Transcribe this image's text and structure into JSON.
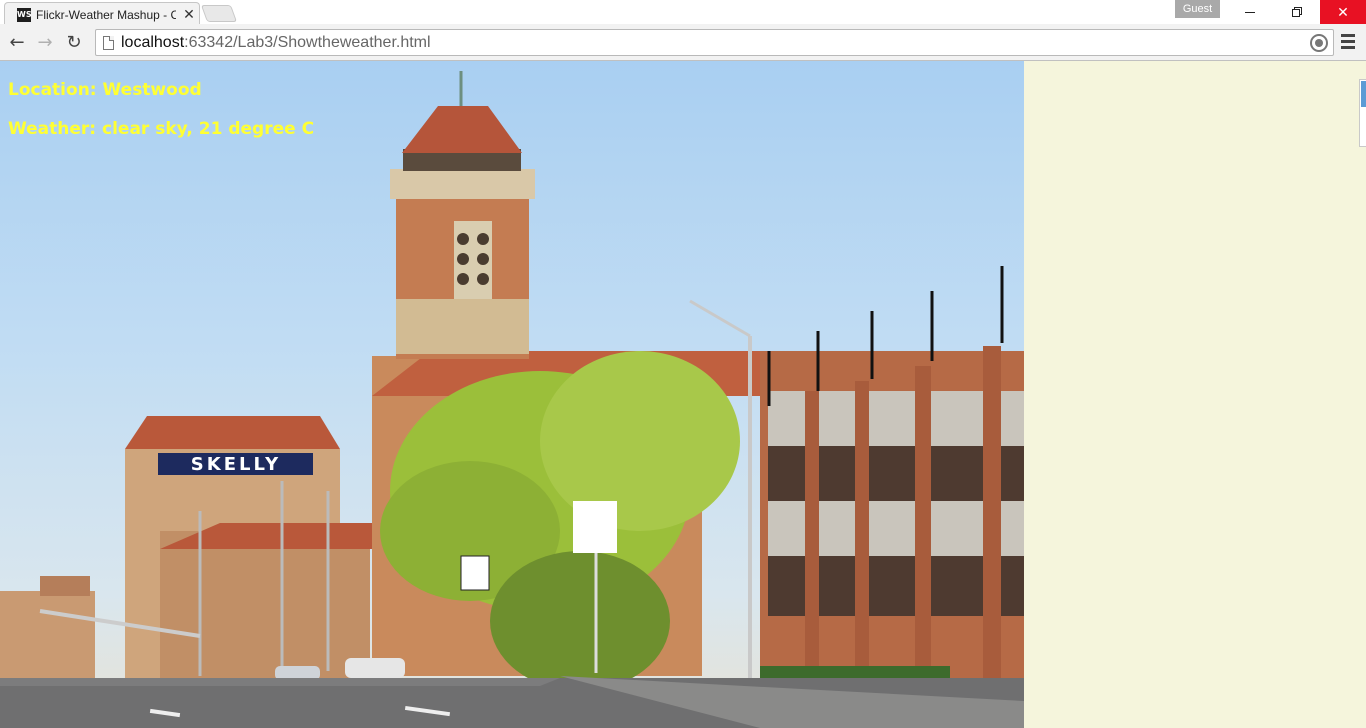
{
  "browser": {
    "tab_title": "Flickr-Weather Mashup - C",
    "tab_favicon": "WS",
    "guest_label": "Guest",
    "url_host": "localhost",
    "url_path": ":63342/Lab3/Showtheweather.html",
    "icons": {
      "back": "back-arrow-icon",
      "forward": "forward-arrow-icon",
      "reload": "reload-icon",
      "page": "page-icon",
      "location": "location-icon",
      "menu": "hamburger-menu-icon",
      "close_tab": "close-icon",
      "minimize": "minimize-icon",
      "restore": "restore-icon",
      "close_window": "close-icon"
    }
  },
  "page": {
    "location_line": "Location: Westwood",
    "weather_line": "Weather: clear sky, 21 degree C",
    "photo_sign_text": "SKELLY",
    "colors": {
      "info_text": "#ffff33",
      "page_background": "#f5f5dc",
      "sky": "#a9cff2",
      "close_button": "#e81123"
    }
  }
}
